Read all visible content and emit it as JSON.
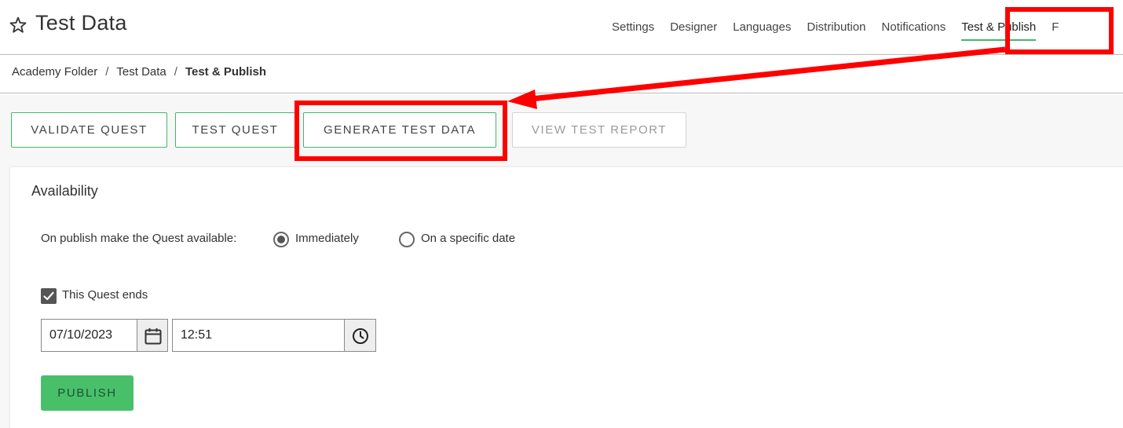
{
  "header": {
    "title": "Test Data",
    "nav": [
      "Settings",
      "Designer",
      "Languages",
      "Distribution",
      "Notifications",
      "Test & Publish",
      "F"
    ],
    "active_tab": "Test & Publish"
  },
  "breadcrumb": [
    "Academy Folder",
    "Test Data",
    "Test & Publish"
  ],
  "breadcrumb_separator": "/",
  "toolbar": {
    "validate_label": "VALIDATE QUEST",
    "test_label": "TEST QUEST",
    "generate_label": "GENERATE TEST DATA",
    "report_label": "VIEW TEST REPORT"
  },
  "availability": {
    "title": "Availability",
    "label": "On publish make the Quest available:",
    "options": [
      "Immediately",
      "On a specific date"
    ],
    "selected": "Immediately",
    "ends_checked": true,
    "ends_label": "This Quest ends",
    "date": "07/10/2023",
    "time": "12:51",
    "publish_label": "PUBLISH"
  },
  "icons": {
    "favorite": "star-icon",
    "date_picker": "calendar-icon",
    "time_picker": "clock-icon",
    "checkbox": "checkmark-icon"
  },
  "colors": {
    "accent": "#3fb968",
    "publish": "#48c06a",
    "annotation": "#ff0000"
  }
}
